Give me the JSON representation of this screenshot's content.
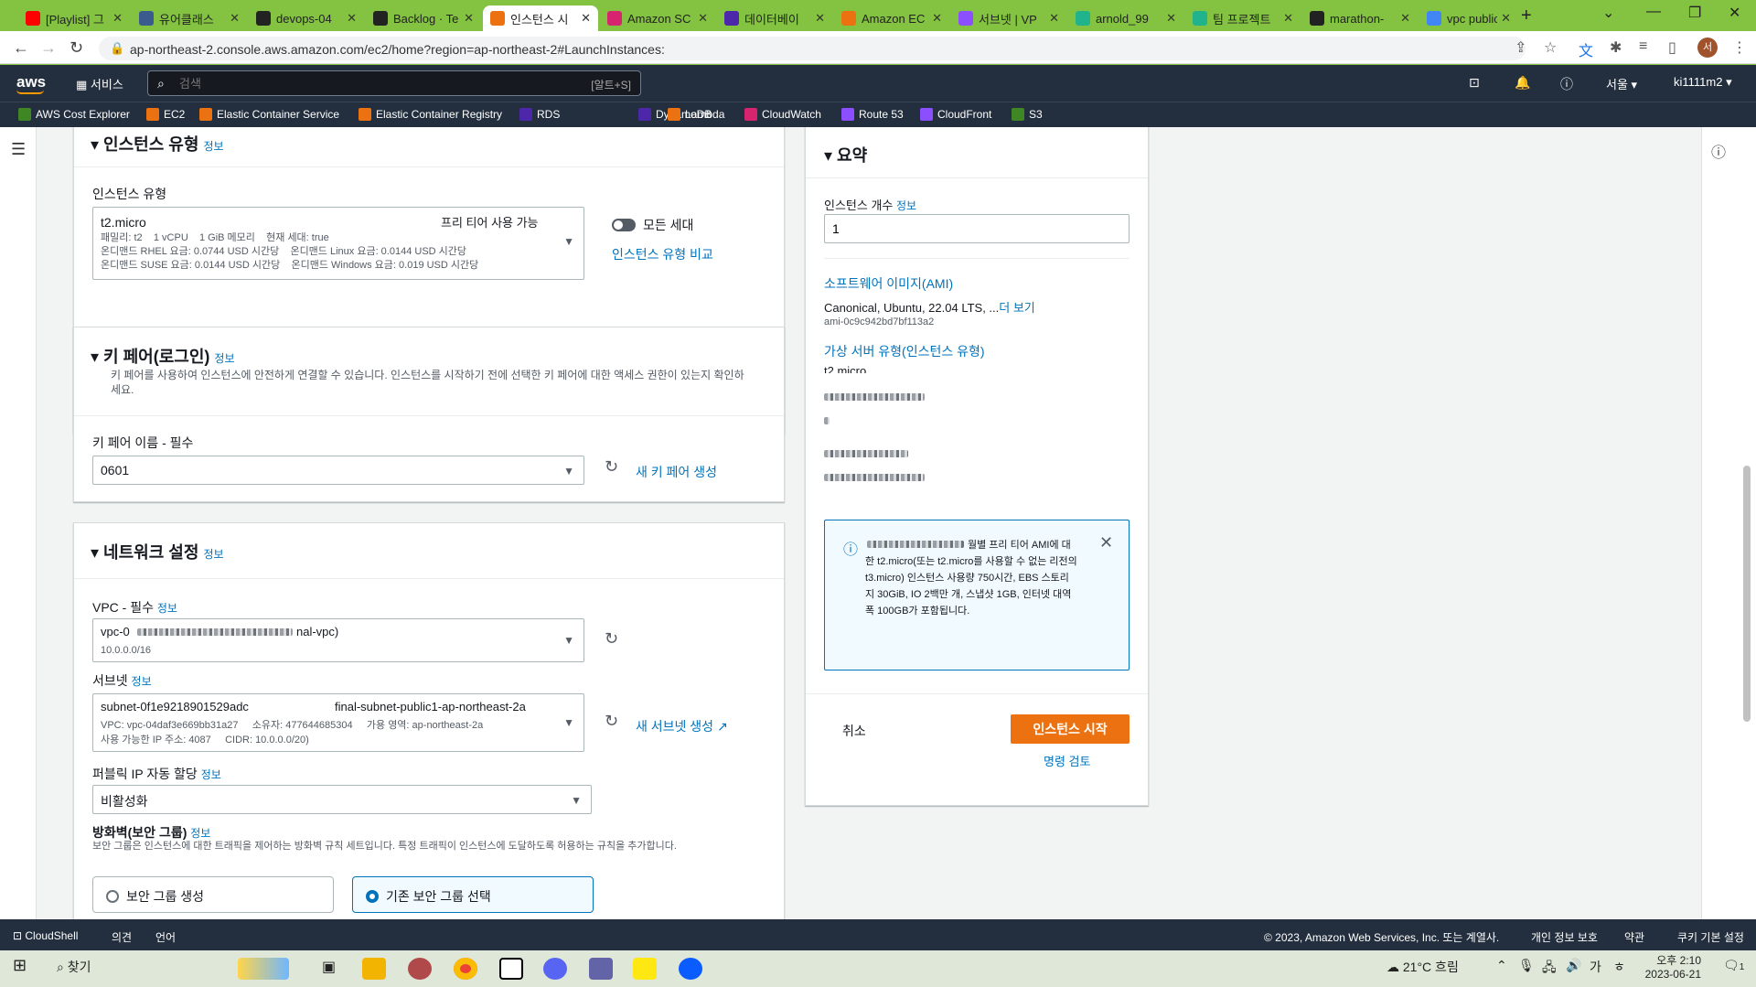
{
  "browser": {
    "tabs": [
      {
        "label": "[Playlist] 그",
        "color": "#ff0000"
      },
      {
        "label": "유어클래스",
        "color": "#3b5b8f"
      },
      {
        "label": "devops-04",
        "color": "#222222"
      },
      {
        "label": "Backlog · Te",
        "color": "#222222"
      },
      {
        "label": "인스턴스 시",
        "color": "#ec7211",
        "active": true
      },
      {
        "label": "Amazon SC",
        "color": "#d6246e"
      },
      {
        "label": "데이터베이",
        "color": "#4d27aa"
      },
      {
        "label": "Amazon EC",
        "color": "#ec7211"
      },
      {
        "label": "서브넷 | VP",
        "color": "#8c4fff"
      },
      {
        "label": "arnold_99",
        "color": "#20b38c"
      },
      {
        "label": "팀 프로젝트",
        "color": "#20b38c"
      },
      {
        "label": "marathon-",
        "color": "#222222"
      },
      {
        "label": "vpc public",
        "color": "#4285f4"
      }
    ],
    "url": "ap-northeast-2.console.aws.amazon.com/ec2/home?region=ap-northeast-2#LaunchInstances:",
    "profile_initial": "서"
  },
  "aws_nav": {
    "logo": "aws",
    "services_label": "서비스",
    "search_placeholder": "검색",
    "search_shortcut": "[알트+S]",
    "region": "서울 ▾",
    "account": "ki1111m2 ▾"
  },
  "favorites": [
    {
      "label": "AWS Cost Explorer",
      "color": "#3f8624"
    },
    {
      "label": "EC2",
      "color": "#ec7211"
    },
    {
      "label": "Elastic Container Service",
      "color": "#ec7211"
    },
    {
      "label": "Elastic Container Registry",
      "color": "#ec7211"
    },
    {
      "label": "RDS",
      "color": "#4d27aa"
    },
    {
      "label": "DynamoDB",
      "color": "#4d27aa"
    },
    {
      "label": "Lambda",
      "color": "#ec7211"
    },
    {
      "label": "CloudWatch",
      "color": "#d6246e"
    },
    {
      "label": "Route 53",
      "color": "#8c4fff"
    },
    {
      "label": "CloudFront",
      "color": "#8c4fff"
    },
    {
      "label": "S3",
      "color": "#3f8624"
    }
  ],
  "instance_type": {
    "heading": "인스턴스 유형",
    "info": "정보",
    "field_label": "인스턴스 유형",
    "selected": "t2.micro",
    "free_tier": "프리 티어 사용 가능",
    "detail1": "패밀리: t2    1 vCPU    1 GiB 메모리    현재 세대: true",
    "detail2": "온디맨드 RHEL 요금: 0.0744 USD 시간당    온디맨드 Linux 요금: 0.0144 USD 시간당",
    "detail3": "온디맨드 SUSE 요금: 0.0144 USD 시간당    온디맨드 Windows 요금: 0.019 USD 시간당",
    "toggle_label": "모든 세대",
    "compare_link": "인스턴스 유형 비교"
  },
  "key_pair": {
    "heading": "키 페어(로그인)",
    "info": "정보",
    "desc": "키 페어를 사용하여 인스턴스에 안전하게 연결할 수 있습니다. 인스턴스를 시작하기 전에 선택한 키 페어에 대한 액세스 권한이 있는지 확인하세요.",
    "field_label": "키 페어 이름 - 필수",
    "selected": "0601",
    "create_link": "새 키 페어 생성"
  },
  "network": {
    "heading": "네트워크 설정",
    "info": "정보",
    "vpc_label": "VPC - 필수",
    "vpc_info": "정보",
    "vpc_value": "vpc-0",
    "vpc_value_tail": "nal-vpc)",
    "vpc_cidr": "10.0.0.0/16",
    "subnet_label": "서브넷",
    "subnet_info": "정보",
    "subnet_id": "subnet-0f1e9218901529adc",
    "subnet_name": "final-subnet-public1-ap-northeast-2a",
    "subnet_detail1": "VPC: vpc-04daf3e669bb31a27     소유자: 477644685304     가용 영역: ap-northeast-2a",
    "subnet_detail2": "사용 가능한 IP 주소: 4087     CIDR: 10.0.0.0/20)",
    "create_subnet": "새 서브넷 생성",
    "public_ip_label": "퍼블릭 IP 자동 할당",
    "public_ip_info": "정보",
    "public_ip_value": "비활성화",
    "sg_label": "방화벽(보안 그룹)",
    "sg_info": "정보",
    "sg_desc": "보안 그룹은 인스턴스에 대한 트래픽을 제어하는 방화벽 규칙 세트입니다. 특정 트래픽이 인스턴스에 도달하도록 허용하는 규칙을 추가합니다.",
    "sg_option1": "보안 그룹 생성",
    "sg_option2": "기존 보안 그룹 선택"
  },
  "summary": {
    "heading": "요약",
    "count_label": "인스턴스 개수",
    "count_info": "정보",
    "count_value": "1",
    "ami_link": "소프트웨어 이미지(AMI)",
    "ami_name": "Canonical, Ubuntu, 22.04 LTS, ...",
    "ami_more": "더 보기",
    "ami_id": "ami-0c9c942bd7bf113a2",
    "type_link": "가상 서버 유형(인스턴스 유형)",
    "type_value": "t2.micro",
    "tip_text": "월별 프리 티어 AMI에 대한 t2.micro(또는 t2.micro를 사용할 수 없는 리전의 t3.micro) 인스턴스 사용량 750시간, EBS 스토리지 30GiB, IO 2백만 개, 스냅샷 1GB, 인터넷 대역폭 100GB가 포함됩니다.",
    "cancel": "취소",
    "launch": "인스턴스 시작",
    "review": "명령 검토"
  },
  "footer": {
    "cloudshell": "CloudShell",
    "feedback": "의견",
    "language": "언어",
    "copyright": "© 2023, Amazon Web Services, Inc. 또는 계열사.",
    "privacy": "개인 정보 보호",
    "terms": "약관",
    "cookies": "쿠키 기본 설정"
  },
  "taskbar": {
    "search": "찾기",
    "weather": "21°C 흐림",
    "ime": "가",
    "time": "오후 2:10",
    "date": "2023-06-21",
    "notif_count": "1"
  }
}
